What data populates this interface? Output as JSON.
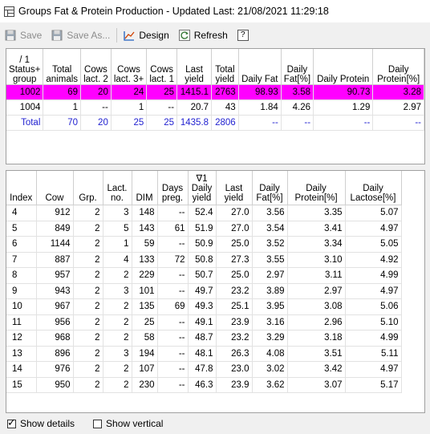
{
  "window": {
    "title": "Groups Fat & Protein Production - Updated Last: 21/08/2021 11:29:18"
  },
  "toolbar": {
    "save_label": "Save",
    "save_as_label": "Save As...",
    "design_label": "Design",
    "refresh_label": "Refresh",
    "help_label": "?"
  },
  "groups_table": {
    "headers": [
      "/ 1\nStatus+\ngroup",
      "Total\nanimals",
      "Cows\nlact. 2",
      "Cows\nlact. 3+",
      "Cows\nlact. 1",
      "Last\nyield",
      "Total\nyield",
      "Daily Fat",
      "Daily\nFat[%]",
      "Daily Protein",
      "Daily\nProtein[%]"
    ],
    "rows": [
      {
        "highlight": true,
        "total": false,
        "cells": [
          "1002",
          "69",
          "20",
          "24",
          "25",
          "1415.1",
          "2763",
          "98.93",
          "3.58",
          "90.73",
          "3.28"
        ]
      },
      {
        "highlight": false,
        "total": false,
        "cells": [
          "1004",
          "1",
          "--",
          "1",
          "--",
          "20.7",
          "43",
          "1.84",
          "4.26",
          "1.29",
          "2.97"
        ]
      },
      {
        "highlight": false,
        "total": true,
        "cells": [
          "Total",
          "70",
          "20",
          "25",
          "25",
          "1435.8",
          "2806",
          "--",
          "--",
          "--",
          "--"
        ]
      }
    ]
  },
  "cows_table": {
    "headers": [
      "Index",
      "Cow",
      "Grp.",
      "Lact.\nno.",
      "DIM",
      "Days\npreg.",
      "∇1\nDaily\nyield",
      "Last\nyield",
      "Daily\nFat[%]",
      "Daily\nProtein[%]",
      "Daily\nLactose[%]"
    ],
    "rows": [
      [
        "4",
        "912",
        "2",
        "3",
        "148",
        "--",
        "52.4",
        "27.0",
        "3.56",
        "3.35",
        "5.07"
      ],
      [
        "5",
        "849",
        "2",
        "5",
        "143",
        "61",
        "51.9",
        "27.0",
        "3.54",
        "3.41",
        "4.97"
      ],
      [
        "6",
        "1144",
        "2",
        "1",
        "59",
        "--",
        "50.9",
        "25.0",
        "3.52",
        "3.34",
        "5.05"
      ],
      [
        "7",
        "887",
        "2",
        "4",
        "133",
        "72",
        "50.8",
        "27.3",
        "3.55",
        "3.10",
        "4.92"
      ],
      [
        "8",
        "957",
        "2",
        "2",
        "229",
        "--",
        "50.7",
        "25.0",
        "2.97",
        "3.11",
        "4.99"
      ],
      [
        "9",
        "943",
        "2",
        "3",
        "101",
        "--",
        "49.7",
        "23.2",
        "3.89",
        "2.97",
        "4.97"
      ],
      [
        "10",
        "967",
        "2",
        "2",
        "135",
        "69",
        "49.3",
        "25.1",
        "3.95",
        "3.08",
        "5.06"
      ],
      [
        "11",
        "956",
        "2",
        "2",
        "25",
        "--",
        "49.1",
        "23.9",
        "3.16",
        "2.96",
        "5.10"
      ],
      [
        "12",
        "968",
        "2",
        "2",
        "58",
        "--",
        "48.7",
        "23.2",
        "3.29",
        "3.18",
        "4.99"
      ],
      [
        "13",
        "896",
        "2",
        "3",
        "194",
        "--",
        "48.1",
        "26.3",
        "4.08",
        "3.51",
        "5.11"
      ],
      [
        "14",
        "976",
        "2",
        "2",
        "107",
        "--",
        "47.8",
        "23.0",
        "3.02",
        "3.42",
        "4.97"
      ],
      [
        "15",
        "950",
        "2",
        "2",
        "230",
        "--",
        "46.3",
        "23.9",
        "3.62",
        "3.07",
        "5.17"
      ]
    ]
  },
  "footer": {
    "show_details_label": "Show details",
    "show_details_checked": true,
    "show_vertical_label": "Show vertical",
    "show_vertical_checked": false
  },
  "colors": {
    "highlight_row": "#ff00ff",
    "total_text": "#1f1fd0"
  },
  "icons": {
    "app": "table-icon",
    "save": "floppy-disk-icon",
    "save_as": "floppy-disk-icon",
    "design": "chart-design-icon",
    "refresh": "refresh-icon",
    "help": "help-icon"
  }
}
